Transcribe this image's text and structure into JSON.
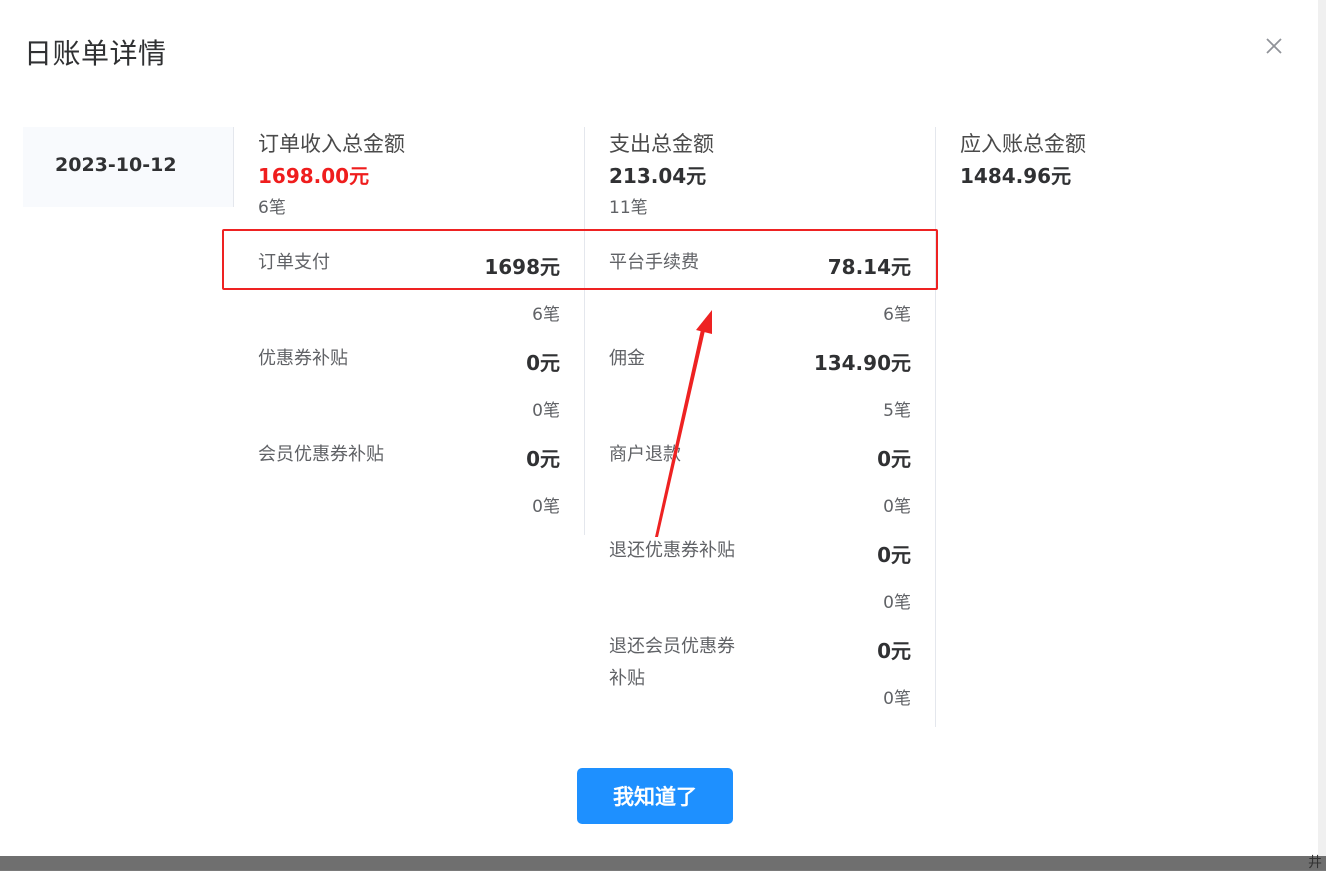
{
  "dialog": {
    "title": "日账单详情",
    "close_icon": "close-icon",
    "confirm_label": "我知道了"
  },
  "date": "2023-10-12",
  "income": {
    "title": "订单收入总金额",
    "amount": "1698.00元",
    "count": "6笔",
    "amount_color": "#ef1d1d",
    "items": [
      {
        "label": "订单支付",
        "value": "1698元",
        "count": "6笔"
      },
      {
        "label": "优惠券补贴",
        "value": "0元",
        "count": "0笔"
      },
      {
        "label": "会员优惠券补贴",
        "value": "0元",
        "count": "0笔"
      }
    ]
  },
  "expense": {
    "title": "支出总金额",
    "amount": "213.04元",
    "count": "11笔",
    "items": [
      {
        "label": "平台手续费",
        "value": "78.14元",
        "count": "6笔"
      },
      {
        "label": "佣金",
        "value": "134.90元",
        "count": "5笔"
      },
      {
        "label": "商户退款",
        "value": "0元",
        "count": "0笔"
      },
      {
        "label": "退还优惠券补贴",
        "value": "0元",
        "count": "0笔"
      },
      {
        "label_line1": "退还会员优惠券",
        "label_line2": "补贴",
        "value": "0元",
        "count": "0笔"
      }
    ]
  },
  "receivable": {
    "title": "应入账总金额",
    "amount": "1484.96元"
  },
  "annotation": {
    "highlight_color": "#ee2222"
  },
  "background_glyph": "井"
}
